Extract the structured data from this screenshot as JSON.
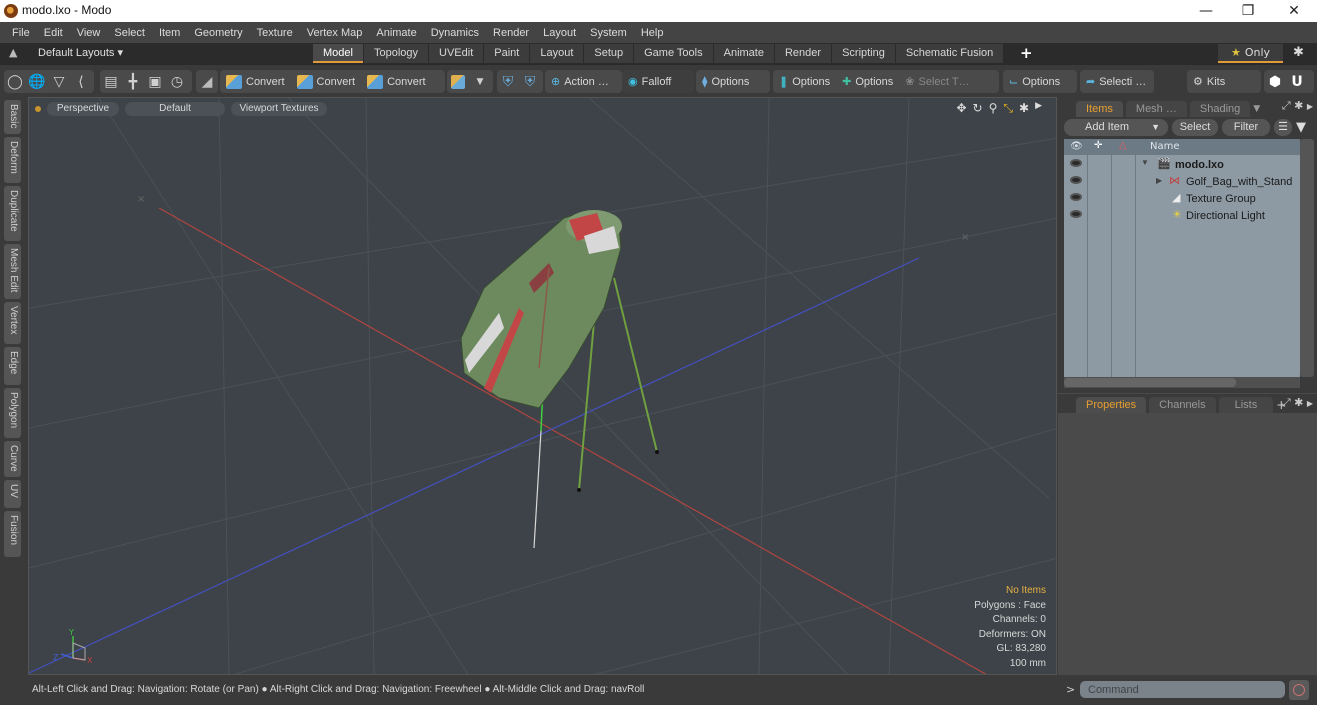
{
  "window": {
    "title": "modo.lxo - Modo",
    "controls": {
      "minimize": "—",
      "restore": "❐",
      "close": "✕"
    }
  },
  "menu": [
    "File",
    "Edit",
    "View",
    "Select",
    "Item",
    "Geometry",
    "Texture",
    "Vertex Map",
    "Animate",
    "Dynamics",
    "Render",
    "Layout",
    "System",
    "Help"
  ],
  "layoutbar": {
    "layouts_label": "Default Layouts ▾",
    "tabs": [
      "Model",
      "Topology",
      "UVEdit",
      "Paint",
      "Layout",
      "Setup",
      "Game Tools",
      "Animate",
      "Render",
      "Scripting",
      "Schematic Fusion"
    ],
    "active_tab": "Model",
    "add_tab": "+",
    "only_label": "Only"
  },
  "toolbar": {
    "select_modes": [
      "vertices",
      "edges-globe",
      "pen",
      "falloff-path"
    ],
    "view_modes": [
      "items",
      "mesh",
      "material",
      "pivot"
    ],
    "convert_buttons": [
      "Convert",
      "Convert",
      "Convert"
    ],
    "action_label": "Action …",
    "falloff_label": "Falloff",
    "options_labels": [
      "Options",
      "Options",
      "Options",
      "Options"
    ],
    "select_t_label": "Select T…",
    "selecti_label": "Selecti …",
    "kits_label": "Kits"
  },
  "left_tabs": [
    "Basic",
    "Deform",
    "Duplicate",
    "Mesh Edit",
    "Vertex",
    "Edge",
    "Polygon",
    "Curve",
    "UV",
    "Fusion"
  ],
  "viewport": {
    "view_mode": "Perspective",
    "shading": "Default",
    "textures": "Viewport Textures",
    "stats": {
      "selection": "No Items",
      "polygons": "Polygons : Face",
      "channels": "Channels: 0",
      "deformers": "Deformers: ON",
      "gl": "GL: 83,280",
      "grid": "100 mm"
    },
    "axis_labels": {
      "x": "X",
      "y": "Y",
      "z": "Z"
    },
    "colors": {
      "x_axis": "#c04a44",
      "z_axis": "#4a5ad0",
      "y_axis": "#40c040",
      "background": "#3d4348",
      "accent": "#e6b040"
    }
  },
  "items_panel": {
    "tabs": [
      "Items",
      "Mesh …",
      "Shading"
    ],
    "active_tab": "Items",
    "add_item": "Add Item",
    "select": "Select",
    "filter": "Filter",
    "column_name": "Name",
    "tree": [
      {
        "name": "modo.lxo",
        "type": "scene",
        "expanded": true,
        "depth": 0
      },
      {
        "name": "Golf_Bag_with_Stand",
        "type": "mesh-locator",
        "expanded": false,
        "depth": 1
      },
      {
        "name": "Texture Group",
        "type": "texture-group",
        "depth": 1
      },
      {
        "name": "Directional Light",
        "type": "light",
        "depth": 1
      }
    ]
  },
  "properties_panel": {
    "tabs": [
      "Properties",
      "Channels",
      "Lists"
    ],
    "active_tab": "Properties",
    "add_tab": "+"
  },
  "statusbar": {
    "hint": "Alt-Left Click and Drag: Navigation: Rotate (or Pan) ● Alt-Right Click and Drag: Navigation: Freewheel ● Alt-Middle Click and Drag: navRoll"
  },
  "command": {
    "prompt": ">",
    "placeholder": "Command"
  }
}
